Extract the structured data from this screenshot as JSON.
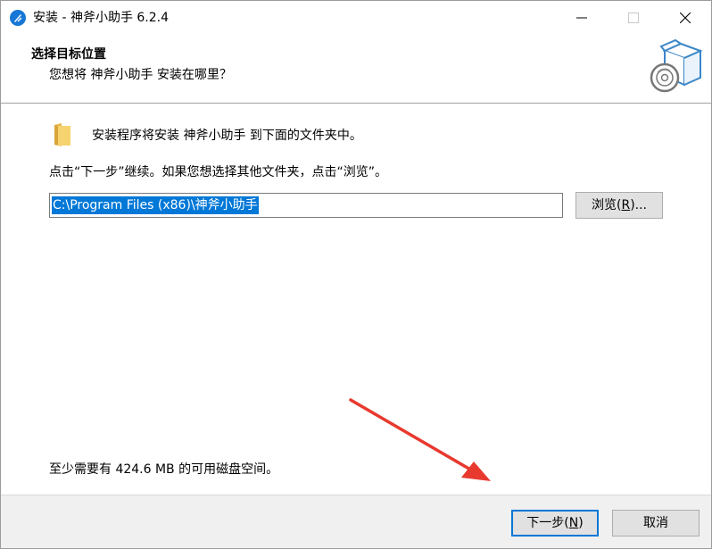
{
  "window": {
    "title": "安装 - 神斧小助手 6.2.4"
  },
  "header": {
    "title": "选择目标位置",
    "subtitle": "您想将 神斧小助手 安装在哪里？"
  },
  "content": {
    "info": "安装程序将安装 神斧小助手 到下面的文件夹中。",
    "instruction": "点击“下一步”继续。如果您想选择其他文件夹，点击“浏览”。",
    "path_value": "C:\\Program Files (x86)\\神斧小助手",
    "browse_label": "浏览(",
    "browse_key": "R",
    "browse_tail": ")...",
    "disk_space": "至少需要有 424.6 MB 的可用磁盘空间。"
  },
  "footer": {
    "next_label": "下一步(",
    "next_key": "N",
    "next_tail": ")",
    "cancel_label": "取消"
  },
  "colors": {
    "accent": "#0078d7",
    "arrow": "#e8392f",
    "folder": "#f4c95d",
    "app_icon": "#1677d6"
  },
  "icons": [
    "app-icon",
    "minimize-icon",
    "maximize-icon",
    "close-icon",
    "setup-box-icon",
    "folder-icon",
    "annotation-arrow"
  ]
}
